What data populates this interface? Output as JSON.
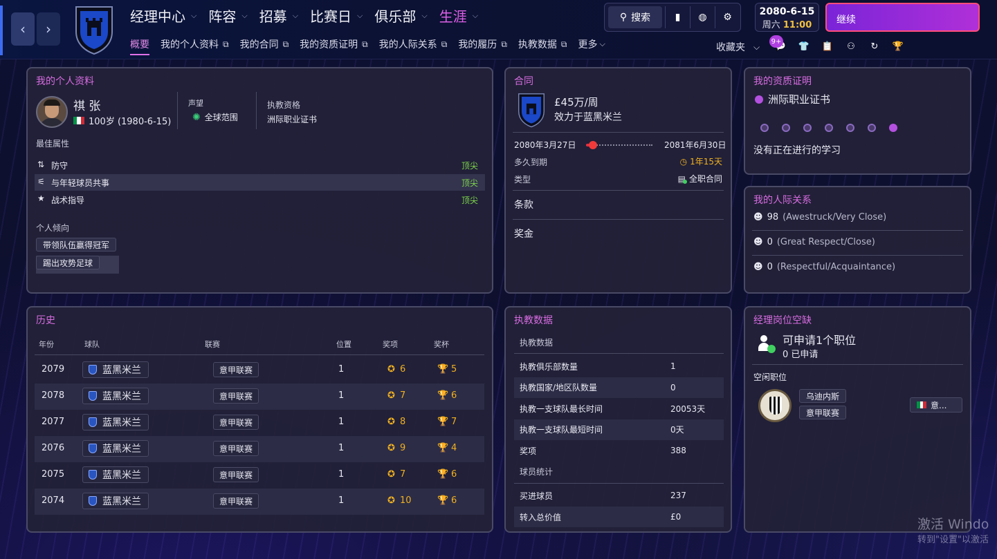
{
  "header": {
    "main_nav": [
      {
        "label": "经理中心"
      },
      {
        "label": "阵容"
      },
      {
        "label": "招募"
      },
      {
        "label": "比赛日"
      },
      {
        "label": "俱乐部"
      },
      {
        "label": "生涯",
        "active": true
      }
    ],
    "sub_nav": [
      {
        "label": "概要",
        "active": true
      },
      {
        "label": "我的个人资料"
      },
      {
        "label": "我的合同"
      },
      {
        "label": "我的资质证明"
      },
      {
        "label": "我的人际关系"
      },
      {
        "label": "我的履历"
      },
      {
        "label": "执教数据"
      }
    ],
    "more_label": "更多",
    "search_label": "搜索",
    "date": "2080-6-15",
    "weekday": "周六",
    "time": "11:00",
    "continue_label": "继续",
    "favorites_label": "收藏夹",
    "inbox_badge": "9+",
    "accent_color": "#e060e8"
  },
  "profile": {
    "title": "我的个人资料",
    "name": "祺 张",
    "age_dob": "100岁 (1980-6-15)",
    "reputation_label": "声望",
    "reputation_value": "全球范围",
    "license_label": "执教资格",
    "license_value": "洲际职业证书",
    "best_attr_label": "最佳属性",
    "attributes": [
      {
        "name": "防守",
        "level": "顶尖"
      },
      {
        "name": "与年轻球员共事",
        "level": "顶尖"
      },
      {
        "name": "战术指导",
        "level": "顶尖"
      }
    ],
    "tendency_label": "个人倾向",
    "tendencies": [
      "带领队伍赢得冠军",
      "踢出攻势足球"
    ]
  },
  "contract": {
    "title": "合同",
    "wage": "£45万/周",
    "club": "效力于蓝黑米兰",
    "start": "2080年3月27日",
    "end": "2081年6月30日",
    "progress_fraction": 0.06,
    "remaining_label": "多久到期",
    "remaining_value": "1年15天",
    "type_label": "类型",
    "type_value": "全职合同",
    "clauses_label": "条款",
    "bonus_label": "奖金"
  },
  "qualifications": {
    "title": "我的资质证明",
    "current": "洲际职业证书",
    "steps_total": 7,
    "steps_done": 7,
    "study_status": "没有正在进行的学习"
  },
  "relationships": {
    "title": "我的人际关系",
    "items": [
      {
        "count": "98",
        "desc": "(Awestruck/Very Close)"
      },
      {
        "count": "0",
        "desc": "(Great Respect/Close)"
      },
      {
        "count": "0",
        "desc": "(Respectful/Acquaintance)"
      }
    ]
  },
  "history": {
    "title": "历史",
    "columns": [
      "年份",
      "球队",
      "联赛",
      "位置",
      "奖项",
      "奖杯"
    ],
    "rows": [
      {
        "year": "2079",
        "team": "蓝黑米兰",
        "league": "意甲联赛",
        "pos": "1",
        "awards": "6",
        "trophies": "5"
      },
      {
        "year": "2078",
        "team": "蓝黑米兰",
        "league": "意甲联赛",
        "pos": "1",
        "awards": "7",
        "trophies": "6"
      },
      {
        "year": "2077",
        "team": "蓝黑米兰",
        "league": "意甲联赛",
        "pos": "1",
        "awards": "8",
        "trophies": "7"
      },
      {
        "year": "2076",
        "team": "蓝黑米兰",
        "league": "意甲联赛",
        "pos": "1",
        "awards": "9",
        "trophies": "4"
      },
      {
        "year": "2075",
        "team": "蓝黑米兰",
        "league": "意甲联赛",
        "pos": "1",
        "awards": "7",
        "trophies": "6"
      },
      {
        "year": "2074",
        "team": "蓝黑米兰",
        "league": "意甲联赛",
        "pos": "1",
        "awards": "10",
        "trophies": "6"
      }
    ]
  },
  "coaching": {
    "title": "执教数据",
    "section1": "执教数据",
    "stats1": [
      {
        "k": "执教俱乐部数量",
        "v": "1"
      },
      {
        "k": "执教国家/地区队数量",
        "v": "0"
      },
      {
        "k": "执教一支球队最长时间",
        "v": "20053天"
      },
      {
        "k": "执教一支球队最短时间",
        "v": "0天"
      },
      {
        "k": "奖项",
        "v": "388"
      }
    ],
    "section2": "球员统计",
    "stats2": [
      {
        "k": "买进球员",
        "v": "237"
      },
      {
        "k": "转入总价值",
        "v": "£0"
      }
    ]
  },
  "vacancies": {
    "title": "经理岗位空缺",
    "available": "可申请1个职位",
    "applied": "0 已申请",
    "free_label": "空闲职位",
    "club": "乌迪内斯",
    "league": "意甲联赛",
    "nation_short": "意..."
  },
  "watermark": {
    "line1": "激活 Windo",
    "line2": "转到\"设置\"以激活"
  }
}
